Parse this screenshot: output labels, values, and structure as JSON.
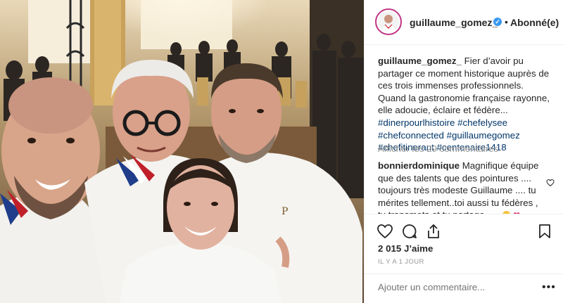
{
  "post": {
    "username": "guillaume_gomez_",
    "verified_mark": "✓",
    "separator": "•",
    "follow_status": "Abonné(e)"
  },
  "caption": {
    "username": "guillaume_gomez_",
    "text": "Fier d’avoir pu partager ce moment historique auprès de ces trois immenses professionnels. Quand la gastronomie française rayonne, elle adoucie, éclaire et fédère...",
    "hashtags_line1": "#dinerpourlhistoire #chefelysee",
    "hashtags_line2": "#chefconnected #guillaumegomez",
    "hashtags_line3": "#chefitinerant #centenaire1418"
  },
  "show_comments": "Afficher les 29 commentaires",
  "comment": {
    "username": "bonnierdominique",
    "text": "Magnifique équipe que des talents que des pointures .... toujours très modeste Guillaume .... tu mérites tellement..toi aussi tu fédères , tu transmets et tu partage ....."
  },
  "likes": "2 015 J’aime",
  "timestamp": "IL Y A 1 JOUR",
  "add_comment_placeholder": "Ajouter un commentaire...",
  "more_label": "•••",
  "icons": {
    "like": "heart-icon",
    "comment": "comment-icon",
    "share": "share-icon",
    "save": "bookmark-icon"
  },
  "colors": {
    "hashtag": "#003569",
    "verified": "#3897f0",
    "muted": "#999999",
    "text": "#262626"
  }
}
